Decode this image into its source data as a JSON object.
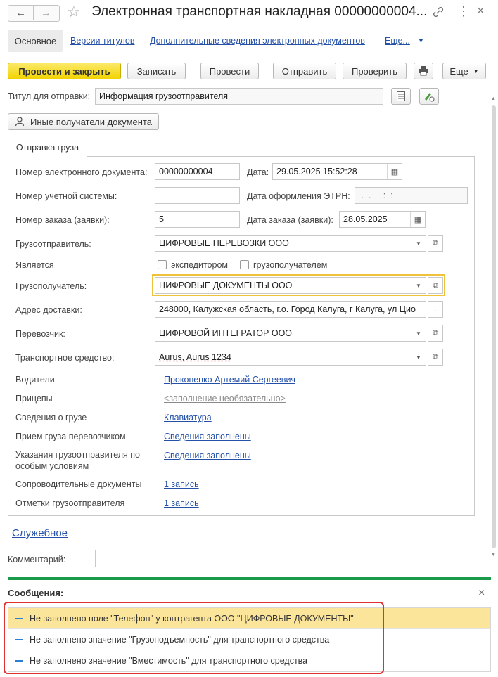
{
  "window": {
    "title": "Электронная транспортная накладная 00000000004...",
    "nav_back": "←",
    "nav_forward": "→"
  },
  "tabs": {
    "main": "Основное",
    "versions": "Версии титулов",
    "additional": "Дополнительные сведения электронных документов",
    "more": "Еще..."
  },
  "toolbar": {
    "post_close": "Провести и закрыть",
    "save": "Записать",
    "post": "Провести",
    "send": "Отправить",
    "check": "Проверить",
    "more": "Еще"
  },
  "title_for_send": {
    "label": "Титул для отправки:",
    "value": "Информация грузоотправителя"
  },
  "other_recipients_btn": "Иные получатели документа",
  "form_tab": "Отправка груза",
  "fields": {
    "doc_number_label": "Номер электронного документа:",
    "doc_number": "00000000004",
    "date_label": "Дата:",
    "date": "29.05.2025 15:52:28",
    "account_number_label": "Номер учетной системы:",
    "account_number": "",
    "etrn_date_label": "Дата оформления ЭТРН:",
    "etrn_date": " .  .     :  :",
    "order_number_label": "Номер заказа (заявки):",
    "order_number": "5",
    "order_date_label": "Дата заказа (заявки):",
    "order_date": "28.05.2025",
    "shipper_label": "Грузоотправитель:",
    "shipper": "ЦИФРОВЫЕ ПЕРЕВОЗКИ ООО",
    "is_label": "Является",
    "forwarder": "экспедитором",
    "consignee_cb": "грузополучателем",
    "consignee_label": "Грузополучатель:",
    "consignee": "ЦИФРОВЫЕ ДОКУМЕНТЫ ООО",
    "address_label": "Адрес доставки:",
    "address": "248000, Калужская область, г.о. Город Калуга, г Калуга, ул Цио",
    "carrier_label": "Перевозчик:",
    "carrier": "ЦИФРОВОЙ ИНТЕГРАТОР ООО",
    "vehicle_label": "Транспортное средство:",
    "vehicle": "Aurus, Aurus 1234",
    "drivers_label": "Водители",
    "drivers": "Прокопенко Артемий Сергеевич",
    "trailers_label": "Прицепы",
    "trailers": "<заполнение необязательно>",
    "cargo_label": "Сведения о грузе",
    "cargo": "Клавиатура",
    "acceptance_label": "Прием груза перевозчиком",
    "acceptance": "Сведения заполнены",
    "instructions_label_1": "Указания грузоотправителя по",
    "instructions_label_2": "особым условиям",
    "instructions": "Сведения заполнены",
    "accompanying_label": "Сопроводительные документы",
    "accompanying": "1 запись",
    "marks_label": "Отметки грузоотправителя",
    "marks": "1 запись"
  },
  "service_link": "Служебное",
  "comment_label": "Комментарий:",
  "messages": {
    "title": "Сообщения:",
    "close": "×",
    "items": [
      "Не заполнено поле \"Телефон\" у контрагента ООО \"ЦИФРОВЫЕ ДОКУМЕНТЫ\"",
      "Не заполнено значение \"Грузоподъемность\" для транспортного средства",
      "Не заполнено значение \"Вместимость\" для транспортного средства"
    ]
  },
  "colors": {
    "accent_yellow": "#f2d400",
    "link_blue": "#2450a8",
    "green_bar": "#1a9a4a",
    "highlight_red": "#e03030",
    "selected_row": "#fbe59a"
  }
}
